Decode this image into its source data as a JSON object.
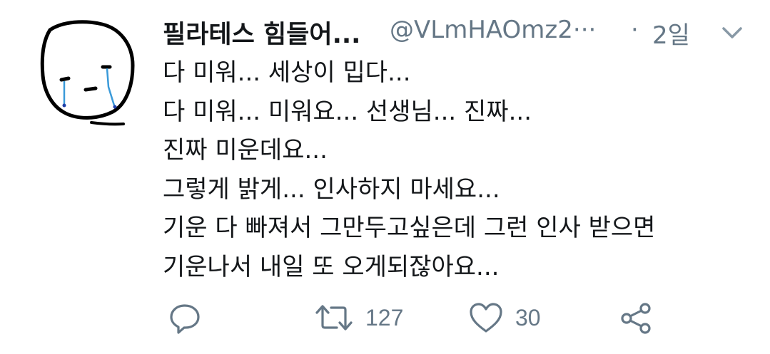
{
  "tweet": {
    "display_name": "필라테스 힘들어...",
    "handle": "@VLmHAOmz2···",
    "separator": "·",
    "timestamp": "2일",
    "avatar_icon": "crying-face-drawing",
    "lines": [
      "다 미워... 세상이 밉다...",
      "다 미워... 미워요... 선생님... 진짜...",
      "진짜 미운데요...",
      "그렇게 밝게... 인사하지 마세요...",
      "기운 다 빠져서 그만두고싶은데 그런 인사 받으면",
      "기운나서 내일 또 오게되잖아요..."
    ]
  },
  "actions": {
    "reply_icon": "reply-icon",
    "retweet_icon": "retweet-icon",
    "retweet_count": "127",
    "like_icon": "heart-icon",
    "like_count": "30",
    "share_icon": "share-icon"
  },
  "colors": {
    "text_primary": "#14171a",
    "text_secondary": "#657786",
    "tear_blue": "#3a9ad9"
  }
}
